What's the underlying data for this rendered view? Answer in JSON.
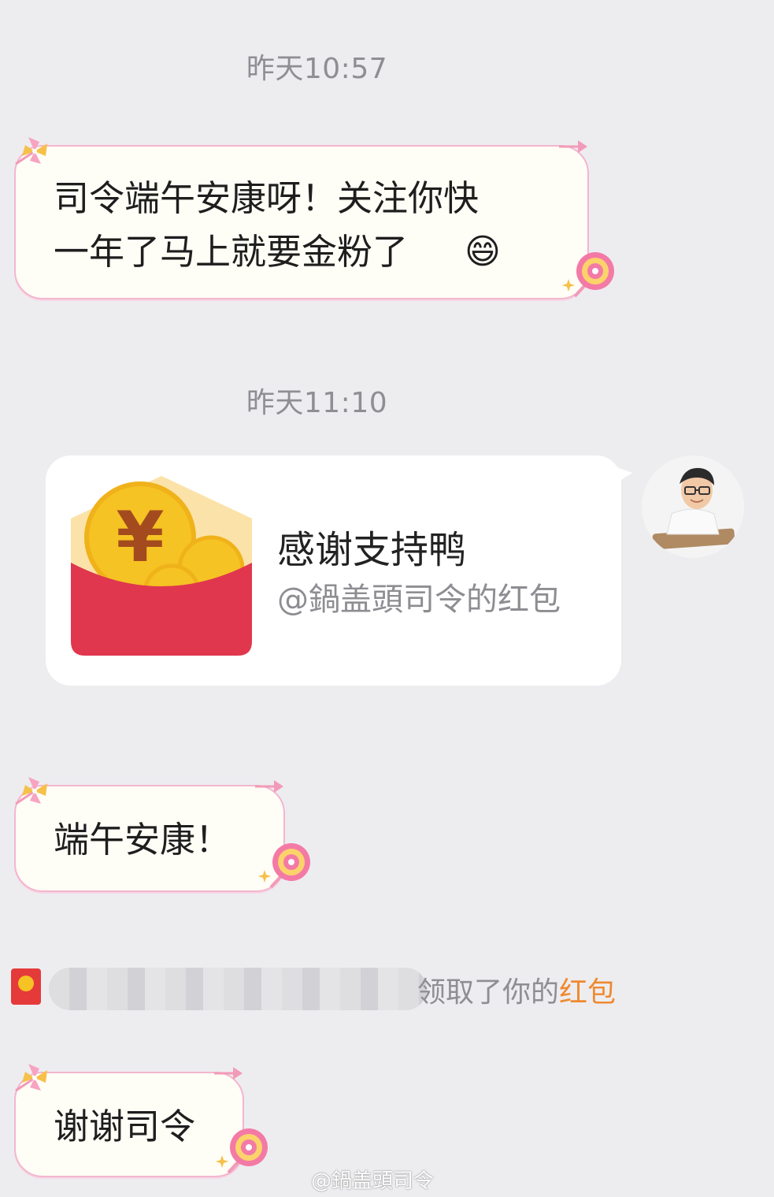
{
  "messages": {
    "time_1": "昨天10:57",
    "msg_1_line_1": "司令端午安康呀！关注你快",
    "msg_1_line_2": "一年了马上就要金粉了",
    "msg_1_emoji": "😄",
    "time_2": "昨天11:10",
    "redpacket": {
      "title": "感谢支持鸭",
      "subtitle": "@鍋盖頭司令的红包",
      "icon": "red-envelope-icon"
    },
    "msg_2": "端午安康！",
    "notice_text": "领取了你的",
    "notice_link": "红包",
    "msg_3": "谢谢司令"
  },
  "watermark": "@鍋盖頭司令",
  "colors": {
    "background": "#ededf0",
    "bubble_fill": "#fefdf6",
    "bubble_border": "#f3b6cf",
    "packet_red": "#e0374f",
    "coin_gold": "#f5c323",
    "notice_link": "#f0892f"
  }
}
